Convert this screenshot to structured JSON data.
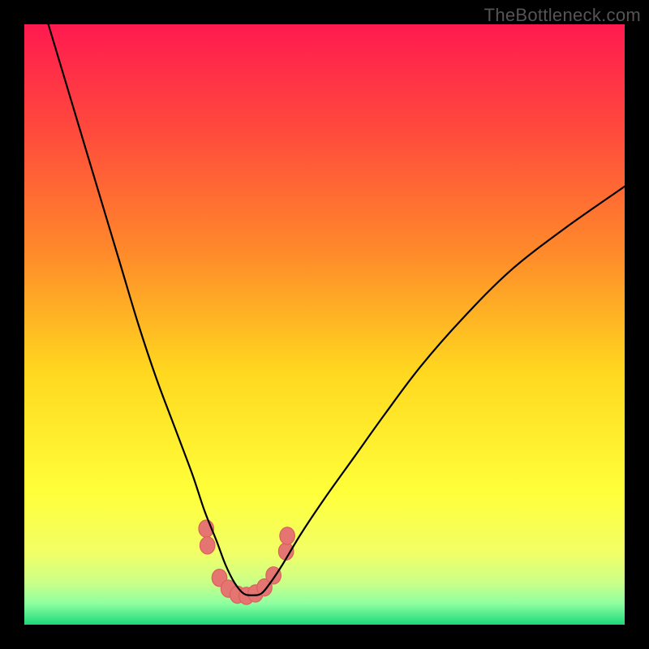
{
  "watermark": "TheBottleneck.com",
  "colors": {
    "frame_bg": "#000000",
    "gradient_stops": [
      {
        "offset": 0.0,
        "color": "#ff1a4f"
      },
      {
        "offset": 0.18,
        "color": "#ff4b3c"
      },
      {
        "offset": 0.38,
        "color": "#ff8a2a"
      },
      {
        "offset": 0.58,
        "color": "#ffd81f"
      },
      {
        "offset": 0.78,
        "color": "#ffff3a"
      },
      {
        "offset": 0.88,
        "color": "#f2ff66"
      },
      {
        "offset": 0.93,
        "color": "#caff88"
      },
      {
        "offset": 0.965,
        "color": "#8effa1"
      },
      {
        "offset": 1.0,
        "color": "#1bd97a"
      }
    ],
    "curve": "#000000",
    "bump_fill": "#e57571",
    "bump_stroke": "#d9615d"
  },
  "chart_data": {
    "type": "line",
    "title": "",
    "xlabel": "",
    "ylabel": "",
    "xlim": [
      0,
      100
    ],
    "ylim": [
      0,
      100
    ],
    "note": "Axes are normalized percentages of the inner plot area. y=0 is the bottom (green end of gradient). Curve is a bottleneck curve: high at left, dips to a minimum ~x=36, rises toward right.",
    "series": [
      {
        "name": "bottleneck_curve",
        "x": [
          4,
          7,
          10,
          13,
          16,
          19,
          22,
          25,
          28,
          30,
          32,
          33.5,
          35,
          36.5,
          38,
          39.5,
          41,
          43,
          46,
          50,
          55,
          60,
          66,
          73,
          81,
          90,
          100
        ],
        "y": [
          100,
          90,
          80,
          70,
          60,
          50,
          41,
          33,
          25,
          19,
          14,
          10,
          7,
          5.2,
          4.9,
          5.2,
          7,
          10,
          15,
          21,
          28,
          35,
          43,
          51,
          59,
          66,
          73
        ]
      }
    ],
    "markers": {
      "name": "highlight_bumps",
      "description": "Pink rounded markers emphasizing the trough region of the curve",
      "points": [
        {
          "x": 30.3,
          "y": 16.0
        },
        {
          "x": 30.5,
          "y": 13.2
        },
        {
          "x": 32.5,
          "y": 7.8
        },
        {
          "x": 34.0,
          "y": 6.0
        },
        {
          "x": 35.5,
          "y": 5.0
        },
        {
          "x": 37.0,
          "y": 4.8
        },
        {
          "x": 38.5,
          "y": 5.2
        },
        {
          "x": 40.0,
          "y": 6.2
        },
        {
          "x": 41.5,
          "y": 8.2
        },
        {
          "x": 43.6,
          "y": 12.2
        },
        {
          "x": 43.8,
          "y": 14.8
        }
      ],
      "radius_pct": 1.25
    }
  }
}
